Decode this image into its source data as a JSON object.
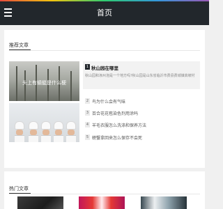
{
  "header": {
    "title": "首页"
  },
  "recommended": {
    "section_title": "推荐文章",
    "image_caption": "头上有蜻蜓是什么梗",
    "featured": {
      "rank": "1",
      "title": "秋山园在哪里",
      "summary": "秋山园和涿州泡是一个地方吗?秋山园是山东省临沂市费县费城镇高坡村"
    },
    "list": [
      {
        "rank": "2",
        "label": "鸟为什么会有气味"
      },
      {
        "rank": "3",
        "label": "百合花花苞染色剂用涂吗"
      },
      {
        "rank": "4",
        "label": "羊毛衣服怎么洗涤和保养方法"
      },
      {
        "rank": "5",
        "label": "螃蟹拿回来怎么保存不会死"
      }
    ]
  },
  "hot": {
    "section_title": "热门文章"
  },
  "colors": {
    "header_bg": "#22272c",
    "page_bg": "#f0f0f0",
    "badge_active": "#22272c"
  }
}
